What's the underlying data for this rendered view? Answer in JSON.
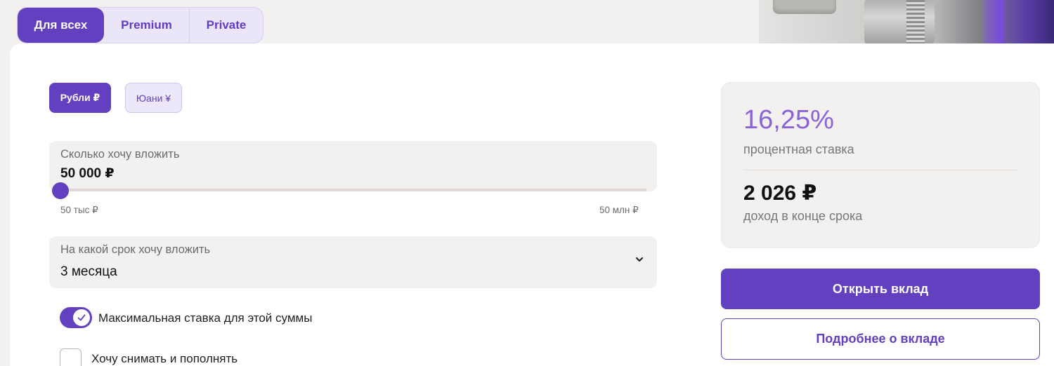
{
  "tabs": [
    {
      "label": "Для всех",
      "active": true
    },
    {
      "label": "Premium",
      "active": false
    },
    {
      "label": "Private",
      "active": false
    }
  ],
  "currency": {
    "options": [
      {
        "label": "Рубли ₽",
        "selected": true
      },
      {
        "label": "Юани ¥",
        "selected": false
      }
    ]
  },
  "amount": {
    "label": "Сколько хочу вложить",
    "value": "50 000 ₽",
    "min_label": "50 тыс ₽",
    "max_label": "50 млн ₽",
    "slider_fraction": 0
  },
  "term": {
    "label": "На какой срок хочу вложить",
    "value": "3 месяца",
    "icon": "chevron-down-icon"
  },
  "options": {
    "max_rate": {
      "label": "Максимальная ставка для этой суммы",
      "on": true
    },
    "withdraw_topup": {
      "label": "Хочу снимать и пополнять",
      "checked": false
    }
  },
  "summary": {
    "rate": "16,25%",
    "rate_label": "процентная ставка",
    "income": "2 026 ₽",
    "income_label": "доход в конце срока"
  },
  "actions": {
    "open": "Открыть вклад",
    "more": "Подробнее о вкладе"
  },
  "colors": {
    "accent": "#6340c0",
    "rate": "#8a63d8",
    "field_bg": "#f3f1ef"
  }
}
